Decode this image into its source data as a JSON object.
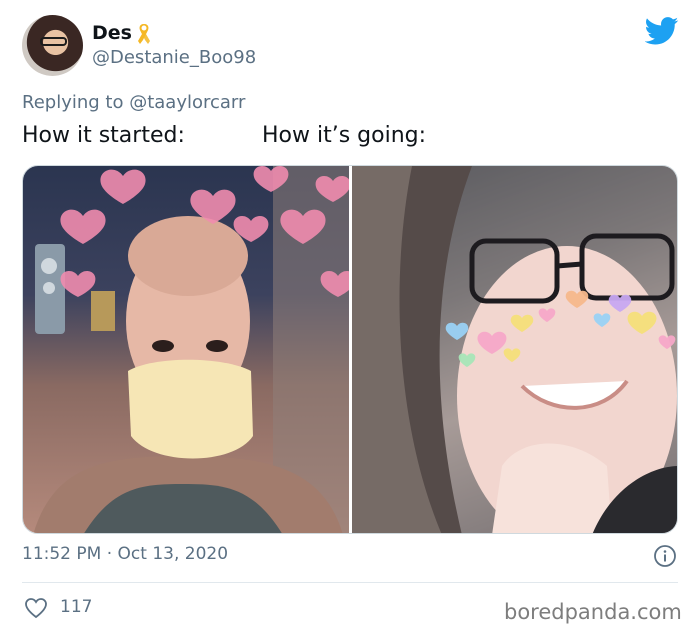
{
  "tweet": {
    "display_name": "Des",
    "handle": "@Destanie_Boo98",
    "replying_prefix": "Replying to ",
    "replying_to": "@taaylorcarr",
    "caption_left": "How it started:",
    "caption_right": "How it’s going:",
    "timestamp": "11:52 PM · Oct 13, 2020",
    "likes": "117"
  },
  "watermark": "boredpanda.com",
  "colors": {
    "twitter_blue": "#1da1f2",
    "secondary_text": "#5b7083",
    "ribbon_gold": "#f5c242"
  },
  "icons": {
    "verified_like": "gold-ribbon-icon",
    "brand": "twitter-bird-icon",
    "info": "info-circle-icon",
    "like": "heart-outline-icon"
  }
}
